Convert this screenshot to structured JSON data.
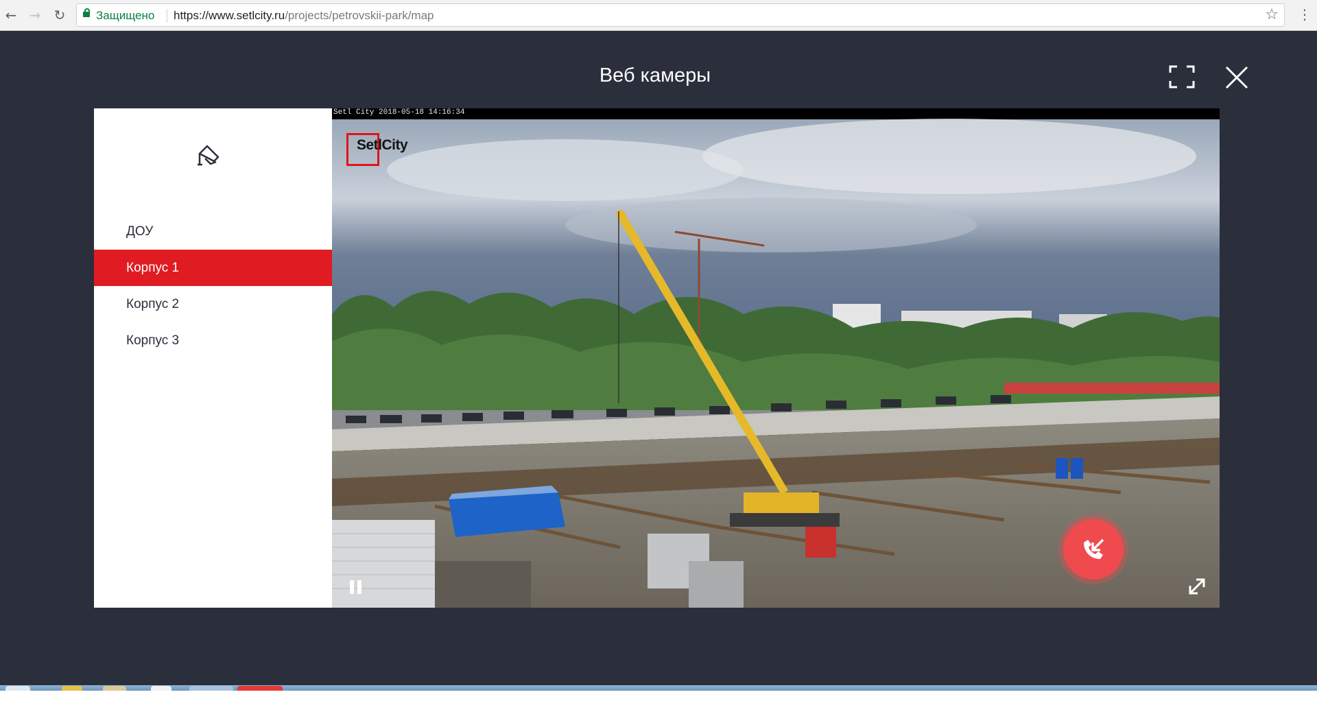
{
  "browser": {
    "security_label": "Защищено",
    "url_host": "https://www.setlcity.ru",
    "url_path": "/projects/petrovskii-park/map"
  },
  "modal": {
    "title": "Веб камеры"
  },
  "sidebar": {
    "items": [
      {
        "label": "ДОУ",
        "active": false
      },
      {
        "label": "Корпус 1",
        "active": true
      },
      {
        "label": "Корпус 2",
        "active": false
      },
      {
        "label": "Корпус 3",
        "active": false
      }
    ]
  },
  "video": {
    "timestamp_overlay": "Setl City 2018-05-18 14:16:34",
    "watermark": "SetlCity"
  },
  "colors": {
    "overlay_bg": "#2b2e3b",
    "accent_red": "#e11b22",
    "callback_red": "#ef4a4e"
  },
  "icons": [
    "back-arrow-icon",
    "forward-arrow-icon",
    "reload-icon",
    "lock-icon",
    "bookmark-star-icon",
    "browser-menu-icon",
    "fullscreen-icon",
    "close-icon",
    "security-camera-icon",
    "pause-icon",
    "expand-icon",
    "phone-callback-icon"
  ]
}
